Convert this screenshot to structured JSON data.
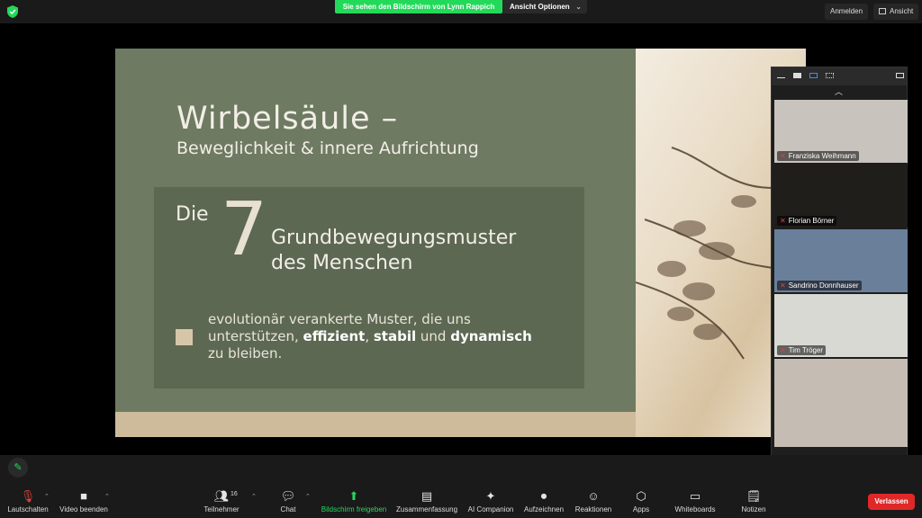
{
  "topbar": {
    "share_banner": "Sie sehen den Bildschirm von Lynn Rappich",
    "view_options": "Ansicht Optionen",
    "sign_in": "Anmelden",
    "view": "Ansicht"
  },
  "slide": {
    "title": "Wirbelsäule –",
    "subtitle": "Beweglichkeit & innere Aufrichtung",
    "box_die": "Die",
    "box_number": "7",
    "box_heading_line1": "Grundbewegungsmuster",
    "box_heading_line2": "des Menschen",
    "bullet_part1": "evolutionär verankerte Muster, die uns unterstützen, ",
    "bullet_bold1": "effizient",
    "bullet_part2": ", ",
    "bullet_bold2": "stabil",
    "bullet_part3": " und ",
    "bullet_bold3": "dynamisch",
    "bullet_part4": " zu bleiben."
  },
  "gallery": {
    "participants": [
      {
        "name": "Franziska Weihmann",
        "color": "#c9c3bd"
      },
      {
        "name": "Florian Börner",
        "color": "#1f1e1b"
      },
      {
        "name": "Sandrino Donnhauser",
        "color": "#6a7f9a"
      },
      {
        "name": "Tim Tröger",
        "color": "#d9d9d4"
      },
      {
        "name": "",
        "color": "#c5bcb4"
      }
    ]
  },
  "toolbar": {
    "mute": "Lautschalten",
    "video": "Video beenden",
    "participants": "Teilnehmer",
    "participants_count": "16",
    "chat": "Chat",
    "share": "Bildschirm freigeben",
    "summary": "Zusammenfassung",
    "ai": "AI Companion",
    "record": "Aufzeichnen",
    "reactions": "Reaktionen",
    "apps": "Apps",
    "whiteboards": "Whiteboards",
    "notes": "Notizen",
    "leave": "Verlassen"
  }
}
